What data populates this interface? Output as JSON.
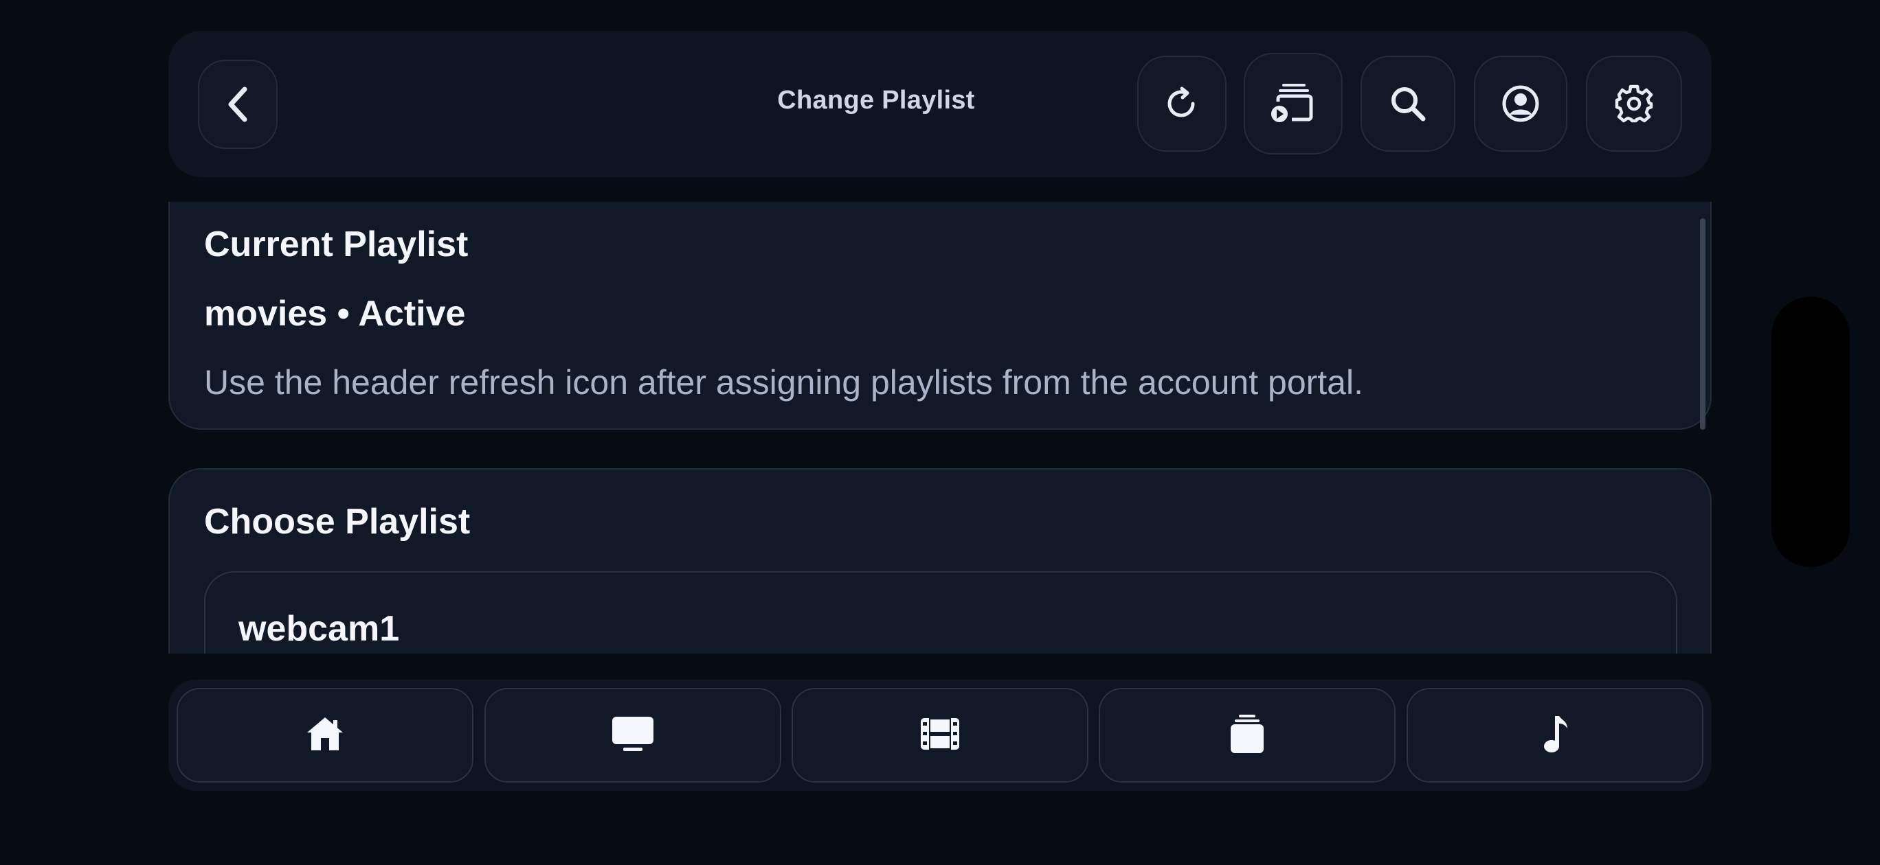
{
  "header": {
    "title": "Change Playlist",
    "buttons": {
      "back": "chevron-left-icon",
      "refresh": "refresh-icon",
      "cast": "cast-icon",
      "search": "search-icon",
      "account": "account-icon",
      "settings": "gear-icon"
    }
  },
  "current_playlist": {
    "title": "Current Playlist",
    "status": "movies • Active",
    "hint": "Use the header refresh icon after assigning playlists from the account portal."
  },
  "choose_playlist": {
    "title": "Choose Playlist",
    "items": [
      {
        "name": "webcam1"
      }
    ]
  },
  "bottom_nav": {
    "items": [
      {
        "icon": "home-icon"
      },
      {
        "icon": "tv-icon"
      },
      {
        "icon": "film-icon"
      },
      {
        "icon": "library-icon"
      },
      {
        "icon": "music-icon"
      }
    ]
  },
  "colors": {
    "background": "#070b14",
    "panel": "#0e1422",
    "card": "#111827",
    "border": "#222b3c",
    "text": "#f4f6fb",
    "muted": "#aab4c8"
  }
}
